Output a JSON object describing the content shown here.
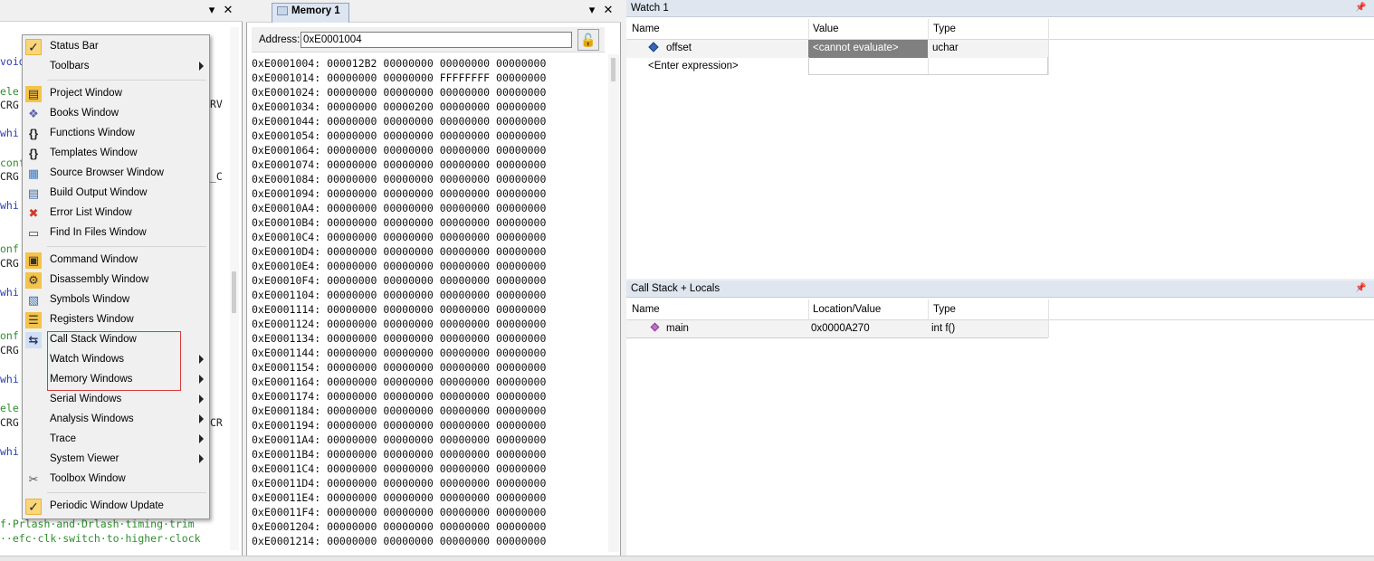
{
  "editor": {
    "code_lines": [
      {
        "text": "void",
        "color": "blue"
      },
      {
        "text": "",
        "color": "black"
      },
      {
        "text": "ele",
        "color": "green"
      },
      {
        "text": "CRG",
        "color": "black"
      },
      {
        "text": "whi",
        "color": "blue"
      },
      {
        "text": "conf",
        "color": "green"
      },
      {
        "text": "CRG",
        "color": "black"
      },
      {
        "text": "whi",
        "color": "blue"
      },
      {
        "text": "onf",
        "color": "green"
      },
      {
        "text": "CRG",
        "color": "black"
      },
      {
        "text": "whi",
        "color": "blue"
      },
      {
        "text": "onf",
        "color": "green"
      },
      {
        "text": "CRG",
        "color": "black"
      },
      {
        "text": "whi",
        "color": "blue"
      },
      {
        "text": "ele",
        "color": "green"
      },
      {
        "text": "CRG",
        "color": "black"
      },
      {
        "text": "whi",
        "color": "blue"
      }
    ],
    "bottom_line_1": "f·Prlash·and·Drlash·timing·trim",
    "bottom_line_2": "··efc·clk·switch·to·higher·clock",
    "right_edge_fragments": [
      "RV",
      "_C",
      "CR"
    ]
  },
  "context_menu": {
    "items": [
      {
        "label": "Status Bar",
        "icon": "check-icon",
        "checked": true,
        "submenu": false
      },
      {
        "label": "Toolbars",
        "icon": "",
        "checked": false,
        "submenu": true
      },
      {
        "label": "Project Window",
        "icon": "project-window-icon",
        "checked": false,
        "submenu": false
      },
      {
        "label": "Books Window",
        "icon": "books-icon",
        "checked": false,
        "submenu": false
      },
      {
        "label": "Functions Window",
        "icon": "functions-icon",
        "checked": false,
        "submenu": false
      },
      {
        "label": "Templates Window",
        "icon": "templates-icon",
        "checked": false,
        "submenu": false
      },
      {
        "label": "Source Browser Window",
        "icon": "source-browser-icon",
        "checked": false,
        "submenu": false
      },
      {
        "label": "Build Output Window",
        "icon": "build-output-icon",
        "checked": false,
        "submenu": false
      },
      {
        "label": "Error List Window",
        "icon": "error-list-icon",
        "checked": false,
        "submenu": false
      },
      {
        "label": "Find In Files Window",
        "icon": "find-in-files-icon",
        "checked": false,
        "submenu": false
      },
      {
        "label": "Command Window",
        "icon": "command-window-icon",
        "checked": false,
        "submenu": false
      },
      {
        "label": "Disassembly Window",
        "icon": "disassembly-icon",
        "checked": false,
        "submenu": false
      },
      {
        "label": "Symbols Window",
        "icon": "symbols-icon",
        "checked": false,
        "submenu": false
      },
      {
        "label": "Registers Window",
        "icon": "registers-icon",
        "checked": false,
        "submenu": false
      },
      {
        "label": "Call Stack Window",
        "icon": "call-stack-icon",
        "checked": false,
        "submenu": false
      },
      {
        "label": "Watch Windows",
        "icon": "",
        "checked": false,
        "submenu": true
      },
      {
        "label": "Memory Windows",
        "icon": "",
        "checked": false,
        "submenu": true
      },
      {
        "label": "Serial Windows",
        "icon": "",
        "checked": false,
        "submenu": true
      },
      {
        "label": "Analysis Windows",
        "icon": "",
        "checked": false,
        "submenu": true
      },
      {
        "label": "Trace",
        "icon": "",
        "checked": false,
        "submenu": true
      },
      {
        "label": "System Viewer",
        "icon": "",
        "checked": false,
        "submenu": true
      },
      {
        "label": "Toolbox Window",
        "icon": "toolbox-icon",
        "checked": false,
        "submenu": false
      },
      {
        "label": "Periodic Window Update",
        "icon": "check-icon",
        "checked": true,
        "submenu": false
      }
    ]
  },
  "memory": {
    "tab_label": "Memory 1",
    "address_label": "Address:",
    "address_value": "0xE0001004",
    "rows": [
      "0xE0001004: 000012B2 00000000 00000000 00000000",
      "0xE0001014: 00000000 00000000 FFFFFFFF 00000000",
      "0xE0001024: 00000000 00000000 00000000 00000000",
      "0xE0001034: 00000000 00000200 00000000 00000000",
      "0xE0001044: 00000000 00000000 00000000 00000000",
      "0xE0001054: 00000000 00000000 00000000 00000000",
      "0xE0001064: 00000000 00000000 00000000 00000000",
      "0xE0001074: 00000000 00000000 00000000 00000000",
      "0xE0001084: 00000000 00000000 00000000 00000000",
      "0xE0001094: 00000000 00000000 00000000 00000000",
      "0xE00010A4: 00000000 00000000 00000000 00000000",
      "0xE00010B4: 00000000 00000000 00000000 00000000",
      "0xE00010C4: 00000000 00000000 00000000 00000000",
      "0xE00010D4: 00000000 00000000 00000000 00000000",
      "0xE00010E4: 00000000 00000000 00000000 00000000",
      "0xE00010F4: 00000000 00000000 00000000 00000000",
      "0xE0001104: 00000000 00000000 00000000 00000000",
      "0xE0001114: 00000000 00000000 00000000 00000000",
      "0xE0001124: 00000000 00000000 00000000 00000000",
      "0xE0001134: 00000000 00000000 00000000 00000000",
      "0xE0001144: 00000000 00000000 00000000 00000000",
      "0xE0001154: 00000000 00000000 00000000 00000000",
      "0xE0001164: 00000000 00000000 00000000 00000000",
      "0xE0001174: 00000000 00000000 00000000 00000000",
      "0xE0001184: 00000000 00000000 00000000 00000000",
      "0xE0001194: 00000000 00000000 00000000 00000000",
      "0xE00011A4: 00000000 00000000 00000000 00000000",
      "0xE00011B4: 00000000 00000000 00000000 00000000",
      "0xE00011C4: 00000000 00000000 00000000 00000000",
      "0xE00011D4: 00000000 00000000 00000000 00000000",
      "0xE00011E4: 00000000 00000000 00000000 00000000",
      "0xE00011F4: 00000000 00000000 00000000 00000000",
      "0xE0001204: 00000000 00000000 00000000 00000000",
      "0xE0001214: 00000000 00000000 00000000 00000000"
    ]
  },
  "watch": {
    "title": "Watch 1",
    "columns": [
      "Name",
      "Value",
      "Type"
    ],
    "rows": [
      {
        "name": "offset",
        "value": "<cannot evaluate>",
        "type": "uchar"
      },
      {
        "name": "<Enter expression>",
        "value": "",
        "type": ""
      }
    ]
  },
  "callstack": {
    "title": "Call Stack + Locals",
    "columns": [
      "Name",
      "Location/Value",
      "Type"
    ],
    "rows": [
      {
        "name": "main",
        "value": "0x0000A270",
        "type": "int f()"
      }
    ]
  },
  "colors": {
    "menu_check": "#fad67a",
    "highlight_border": "#d63a3a",
    "pane_title_bg": "#dfe6ef",
    "cannot_eval_bg": "#808080"
  }
}
